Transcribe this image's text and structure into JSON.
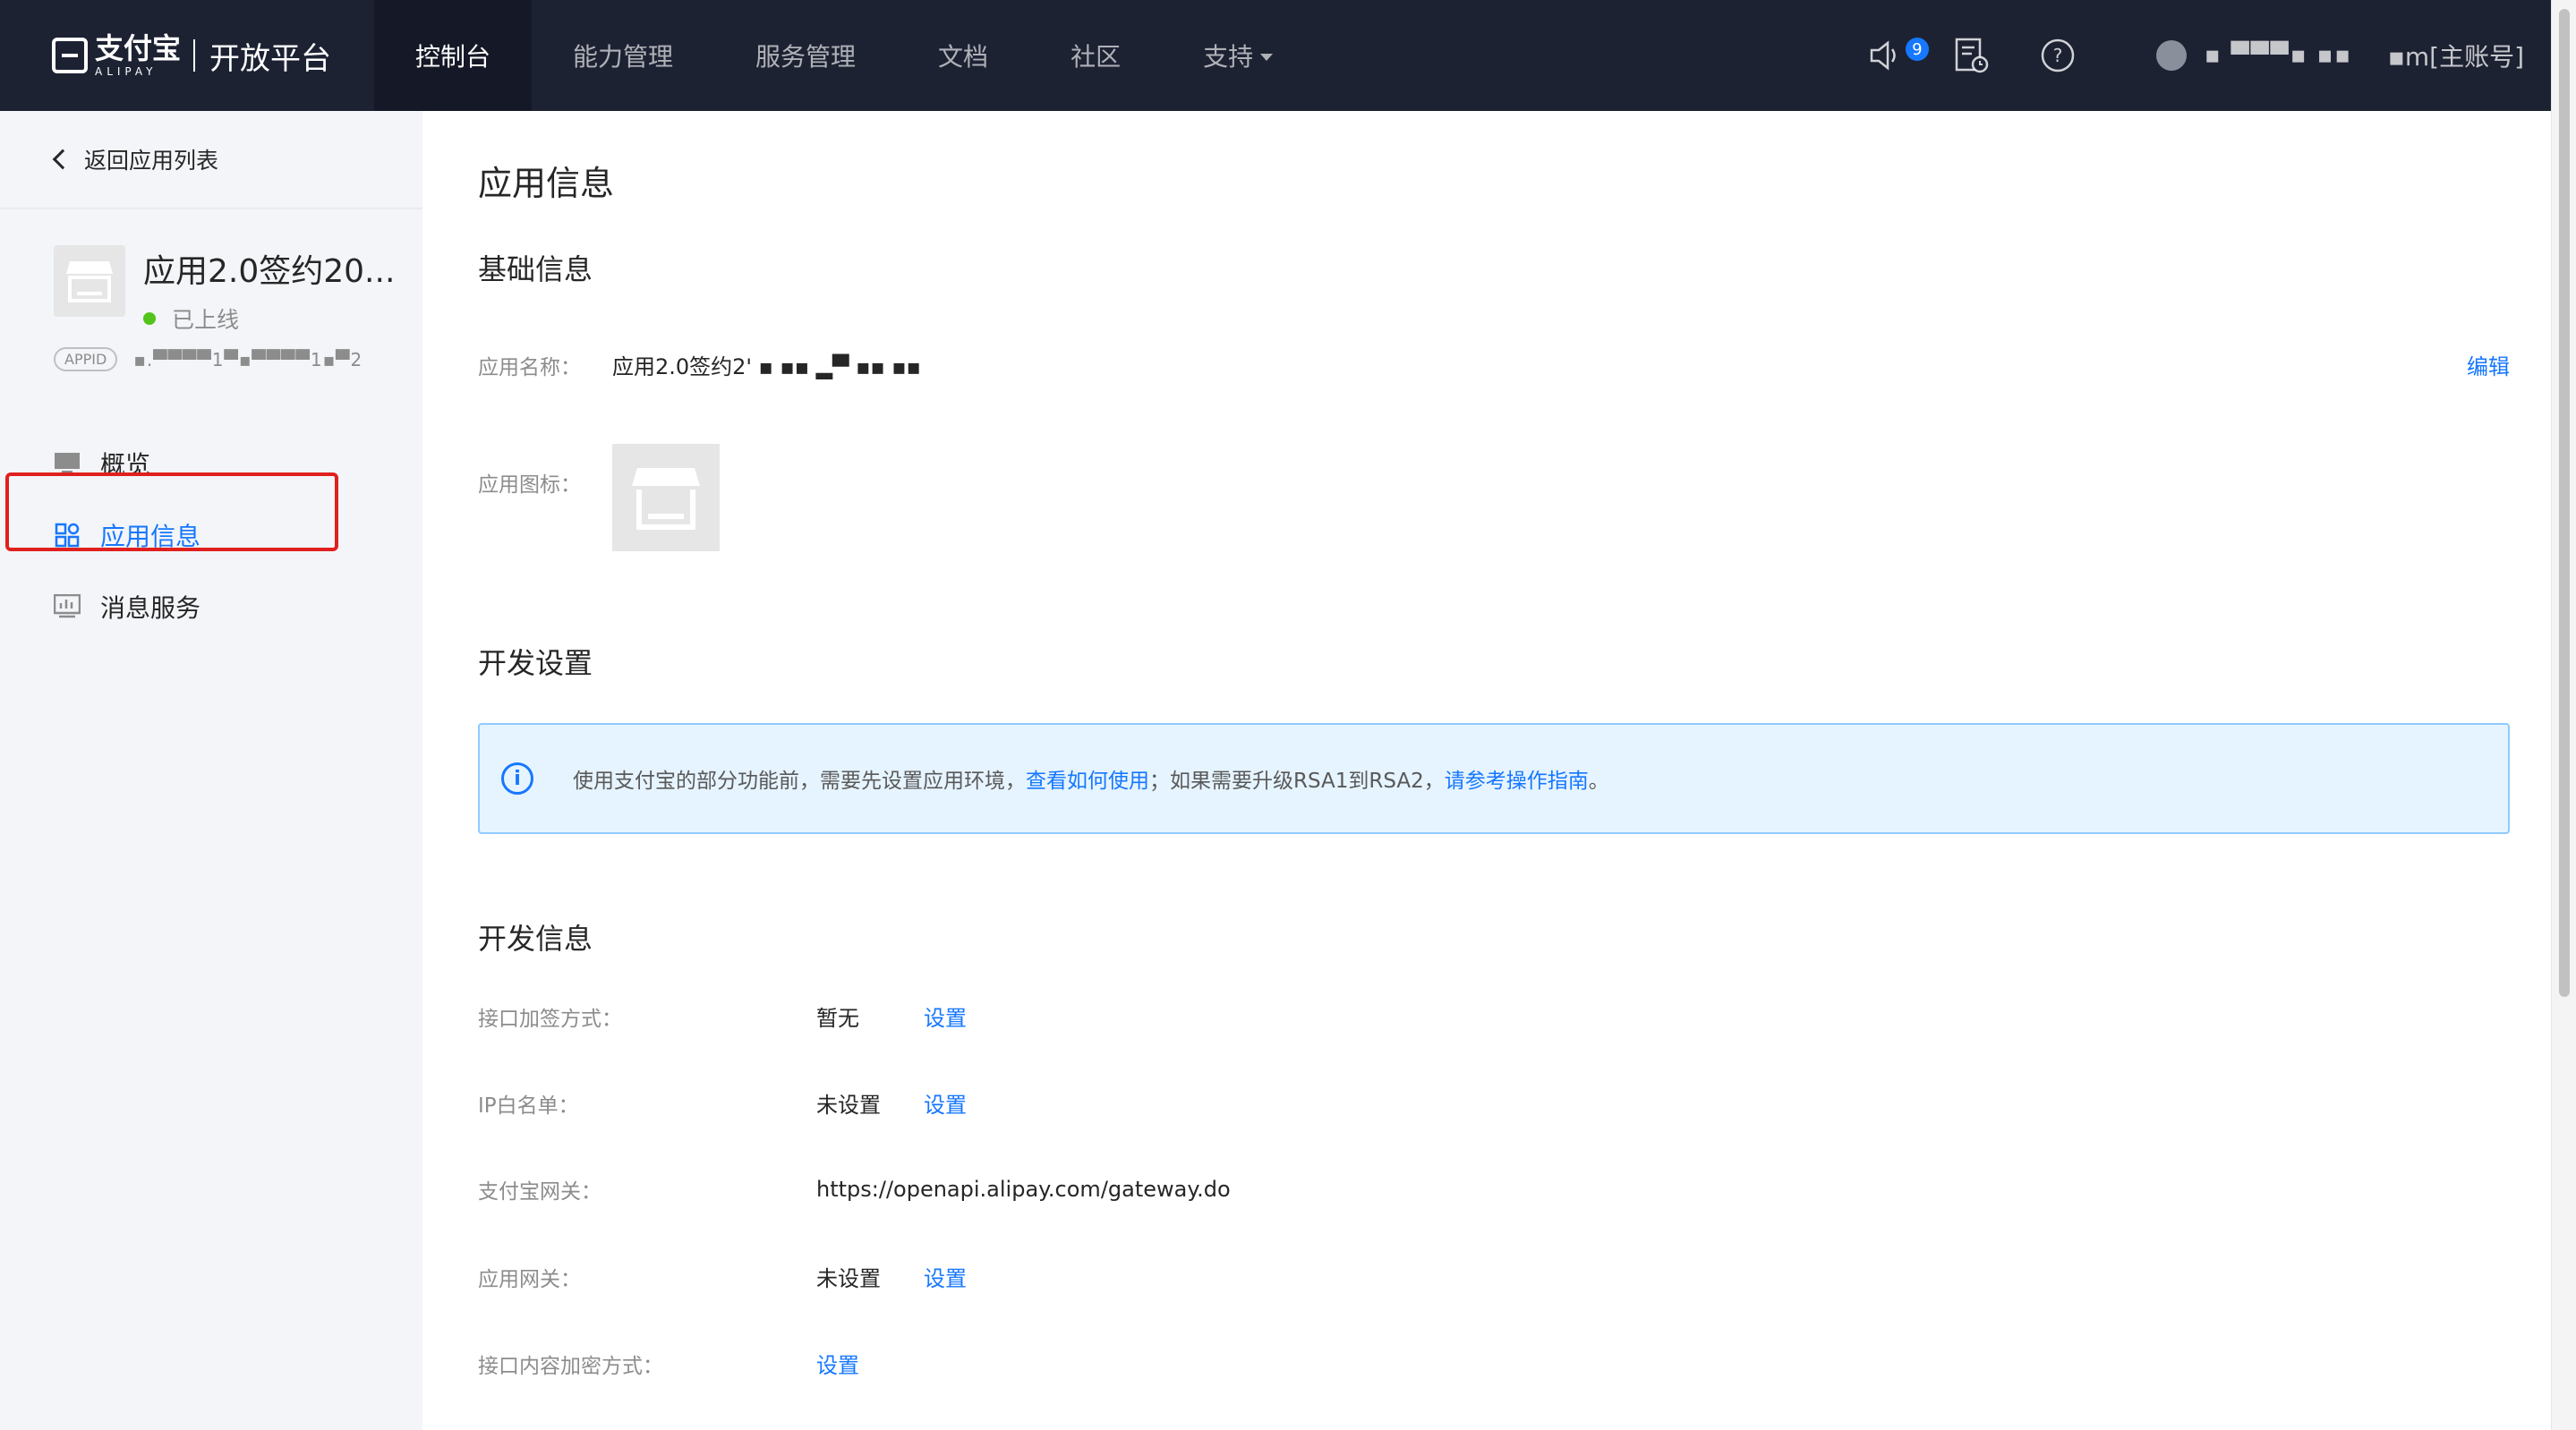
{
  "topbar": {
    "logo_cn": "支付宝",
    "logo_en": "ALIPAY",
    "platform": "开放平台",
    "nav": [
      {
        "label": "控制台",
        "active": true
      },
      {
        "label": "能力管理",
        "active": false
      },
      {
        "label": "服务管理",
        "active": false
      },
      {
        "label": "文档",
        "active": false
      },
      {
        "label": "社区",
        "active": false
      },
      {
        "label": "支持",
        "active": false,
        "dropdown": true
      }
    ],
    "notification_count": "9",
    "user_name": "▪ ▀▀▀▪ ▪▪",
    "account": "▪m[主账号]"
  },
  "sidebar": {
    "back_label": "返回应用列表",
    "app_name": "应用2.0签约20...",
    "app_status": "已上线",
    "appid_tag": "APPID",
    "appid_value": "▪.▀▀▀▀1▀▪▀▀▀▀1▪▀2",
    "menu": [
      {
        "label": "概览",
        "icon": "monitor-icon",
        "active": false
      },
      {
        "label": "应用信息",
        "icon": "grid-icon",
        "active": true
      },
      {
        "label": "消息服务",
        "icon": "chart-icon",
        "active": false
      }
    ]
  },
  "main": {
    "title": "应用信息",
    "basic": {
      "heading": "基础信息",
      "name_label": "应用名称：",
      "name_value": "应用2.0签约2' ▪ ▪▪ ▂▀ ▪▪ ▪▪",
      "edit_label": "编辑",
      "icon_label": "应用图标："
    },
    "dev_settings": {
      "heading": "开发设置",
      "alert_prefix": "使用支付宝的部分功能前，需要先设置应用环境，",
      "alert_link1": "查看如何使用",
      "alert_middle": "；如果需要升级RSA1到RSA2，",
      "alert_link2": "请参考操作指南",
      "alert_suffix": "。"
    },
    "dev_info": {
      "heading": "开发信息",
      "rows": [
        {
          "label": "接口加签方式：",
          "value": "暂无",
          "action": "设置"
        },
        {
          "label": "IP白名单：",
          "value": "未设置",
          "action": "设置"
        },
        {
          "label": "支付宝网关：",
          "value": "https://openapi.alipay.com/gateway.do",
          "action": ""
        },
        {
          "label": "应用网关：",
          "value": "未设置",
          "action": "设置"
        },
        {
          "label": "接口内容加密方式：",
          "value": "",
          "action": "设置"
        }
      ]
    }
  },
  "colors": {
    "accent": "#1677ff",
    "topbar": "#1d2233",
    "highlight": "#e0201d",
    "online": "#52c41a"
  }
}
